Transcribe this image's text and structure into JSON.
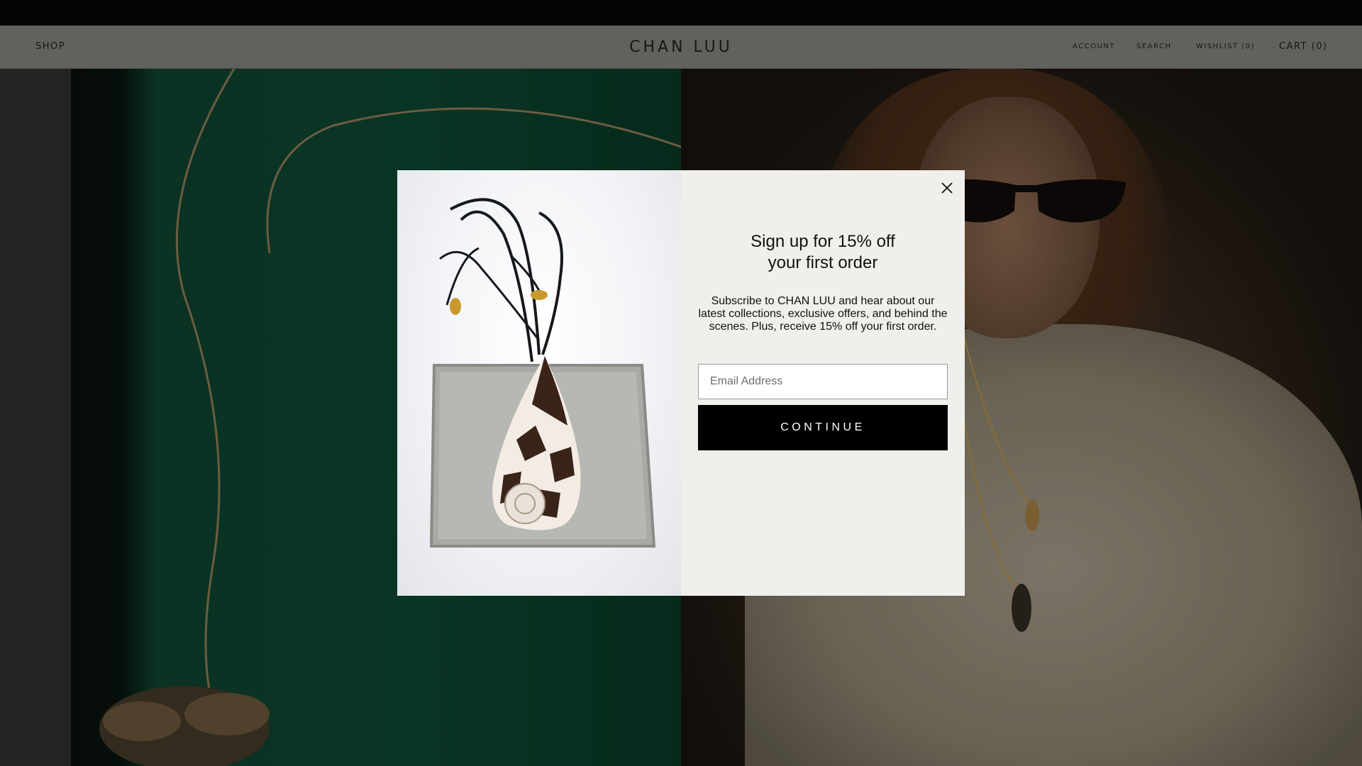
{
  "header": {
    "shop_label": "SHOP",
    "logo_text": "CHAN LUU",
    "account_label": "ACCOUNT",
    "search_label": "SEARCH",
    "wishlist_label": "WISHLIST (0)",
    "cart_label": "CART (0)"
  },
  "signup_modal": {
    "title_line1": "Sign up for 15% off",
    "title_line2": "your first order",
    "body": "Subscribe to CHAN LUU and hear about our latest collections, exclusive offers, and behind the scenes. Plus, receive 15% off your first order.",
    "email_placeholder": "Email Address",
    "continue_label": "CONTINUE",
    "close_icon": "close-icon"
  },
  "colors": {
    "announcement_bar": "#050505",
    "modal_background": "#f1efeb",
    "button_background": "#000000",
    "hero_green": "#0b3d2a"
  }
}
